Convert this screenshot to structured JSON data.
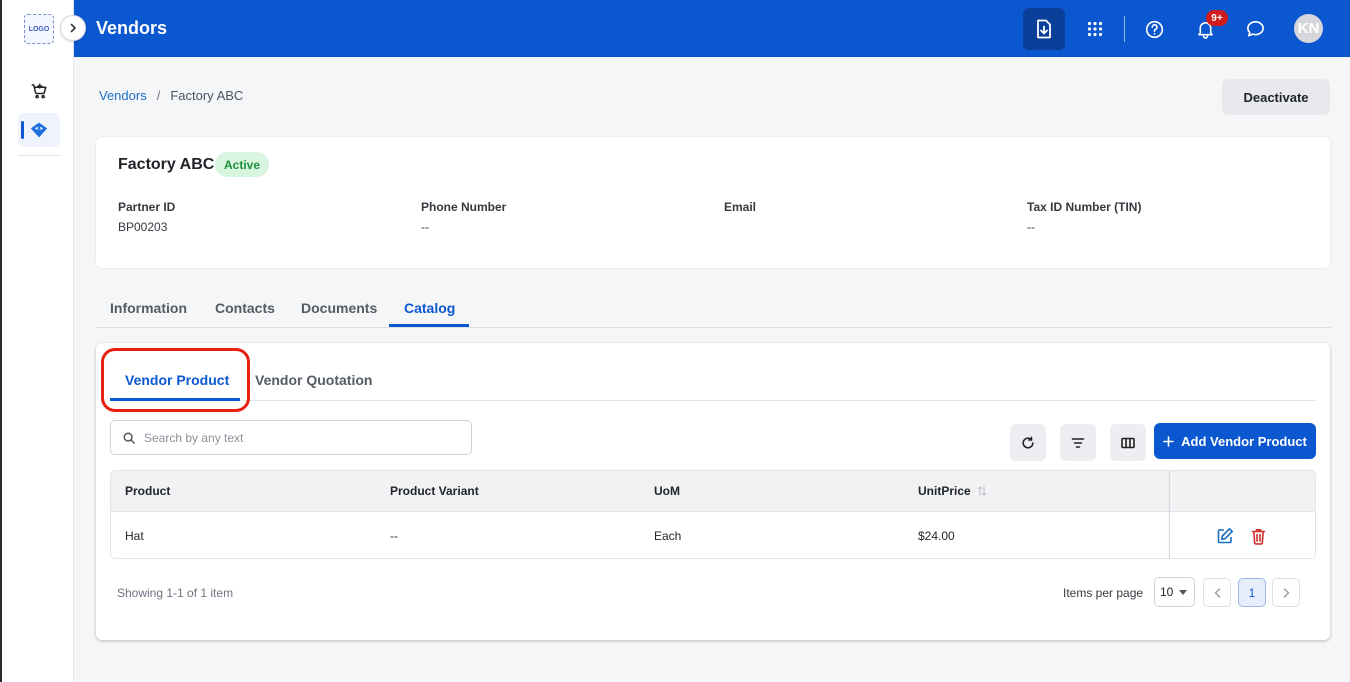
{
  "app": {
    "logo_text": "LOGO",
    "page_title": "Vendors"
  },
  "topbar": {
    "notification_badge": "9+",
    "avatar_initials": "KN"
  },
  "breadcrumb": {
    "root": "Vendors",
    "separator": "/",
    "current": "Factory ABC"
  },
  "actions": {
    "deactivate_label": "Deactivate"
  },
  "vendor": {
    "name": "Factory ABC",
    "status": "Active",
    "fields": [
      {
        "label": "Partner ID",
        "value": "BP00203"
      },
      {
        "label": "Phone Number",
        "value": "--"
      },
      {
        "label": "Email",
        "value": ""
      },
      {
        "label": "Tax ID Number (TIN)",
        "value": "--"
      }
    ]
  },
  "tabs": [
    {
      "label": "Information"
    },
    {
      "label": "Contacts"
    },
    {
      "label": "Documents"
    },
    {
      "label": "Catalog",
      "active": true
    }
  ],
  "subtabs": [
    {
      "label": "Vendor Product",
      "active": true
    },
    {
      "label": "Vendor Quotation"
    }
  ],
  "search": {
    "placeholder": "Search by any text",
    "value": ""
  },
  "toolbar": {
    "add_label": "Add Vendor Product"
  },
  "table": {
    "columns": [
      "Product",
      "Product Variant",
      "UoM",
      "UnitPrice"
    ],
    "rows": [
      {
        "product": "Hat",
        "variant": "--",
        "uom": "Each",
        "unit_price": "$24.00"
      }
    ]
  },
  "pagination": {
    "showing": "Showing 1-1 of 1 item",
    "items_per_page_label": "Items per page",
    "items_per_page": "10",
    "current_page": "1"
  },
  "colors": {
    "primary": "#0b57d0",
    "active_badge_bg": "#d8f5df",
    "active_badge_text": "#1f8f3c",
    "delete": "#d32f2f",
    "highlight": "#e8200f"
  }
}
